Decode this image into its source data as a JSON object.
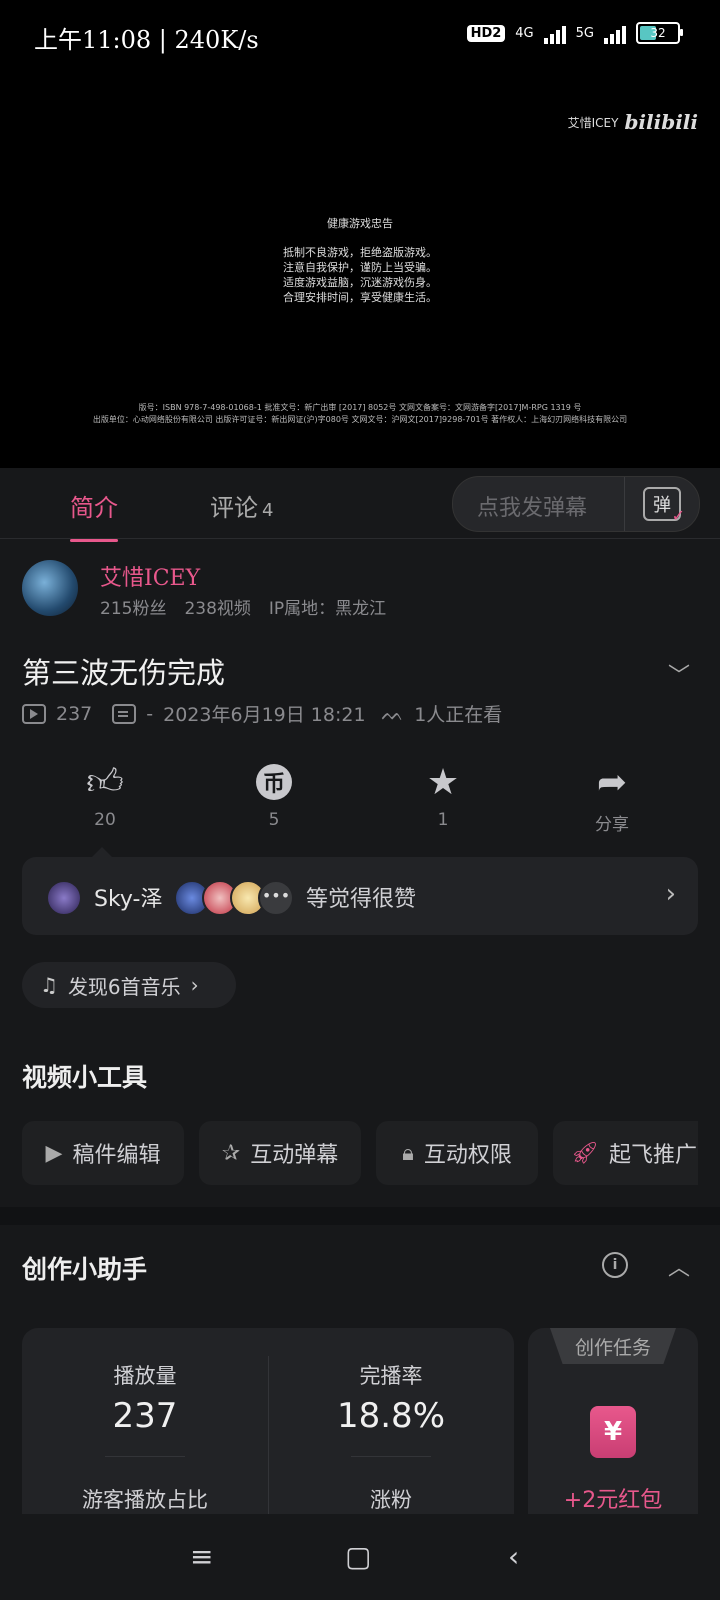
{
  "status_bar": {
    "time": "上午11:08 | 240K/s",
    "network_1": "HD2",
    "network_2": "4G",
    "network_3": "5G",
    "battery": "32"
  },
  "video": {
    "watermark_author": "艾惜ICEY",
    "watermark_brand": "bilibili",
    "warning_title": "健康游戏忠告",
    "warning_lines": [
      "抵制不良游戏，拒绝盗版游戏。",
      "注意自我保护，谨防上当受骗。",
      "适度游戏益脑，沉迷游戏伤身。",
      "合理安排时间，享受健康生活。"
    ],
    "license_1": "版号：ISBN 978-7-498-01068-1 批准文号：新广出审 [2017] 8052号 文网文备案号：文网游备字[2017]M-RPG 1319 号",
    "license_2": "出版单位：心动网络股份有限公司 出版许可证号：新出网证(沪)字080号 文网文号：沪网文[2017]9298-701号 著作权人：上海幻刃网络科技有限公司"
  },
  "tabs": {
    "intro": "简介",
    "comment": "评论",
    "comment_count": "4",
    "danmaku_placeholder": "点我发弹幕",
    "danmaku_icon": "弹"
  },
  "uploader": {
    "name": "艾惜ICEY",
    "fans": "215粉丝",
    "videos": "238视频",
    "ip": "IP属地：黑龙江"
  },
  "video_info": {
    "title": "第三波无伤完成",
    "plays": "237",
    "danmaku_count": "-",
    "date": "2023年6月19日 18:21",
    "watching": "1人正在看"
  },
  "actions": {
    "like": "20",
    "coin": "5",
    "fav": "1",
    "share": "分享"
  },
  "likers": {
    "name": "Sky-泽",
    "text": "等觉得很赞"
  },
  "music": {
    "label": "发现6首音乐"
  },
  "tools": {
    "heading": "视频小工具",
    "items": [
      "稿件编辑",
      "互动弹幕",
      "互动权限",
      "起飞推广"
    ]
  },
  "helper": {
    "heading": "创作小助手",
    "plays_label": "播放量",
    "plays_value": "237",
    "completion_label": "完播率",
    "completion_value": "18.8%",
    "guest_label": "游客播放占比",
    "fans_label": "涨粉",
    "task_tab": "创作任务",
    "task_icon": "¥",
    "task_reward": "+2元红包"
  },
  "colors": {
    "accent": "#e8588c",
    "background": "#17181a",
    "card": "#222326"
  }
}
